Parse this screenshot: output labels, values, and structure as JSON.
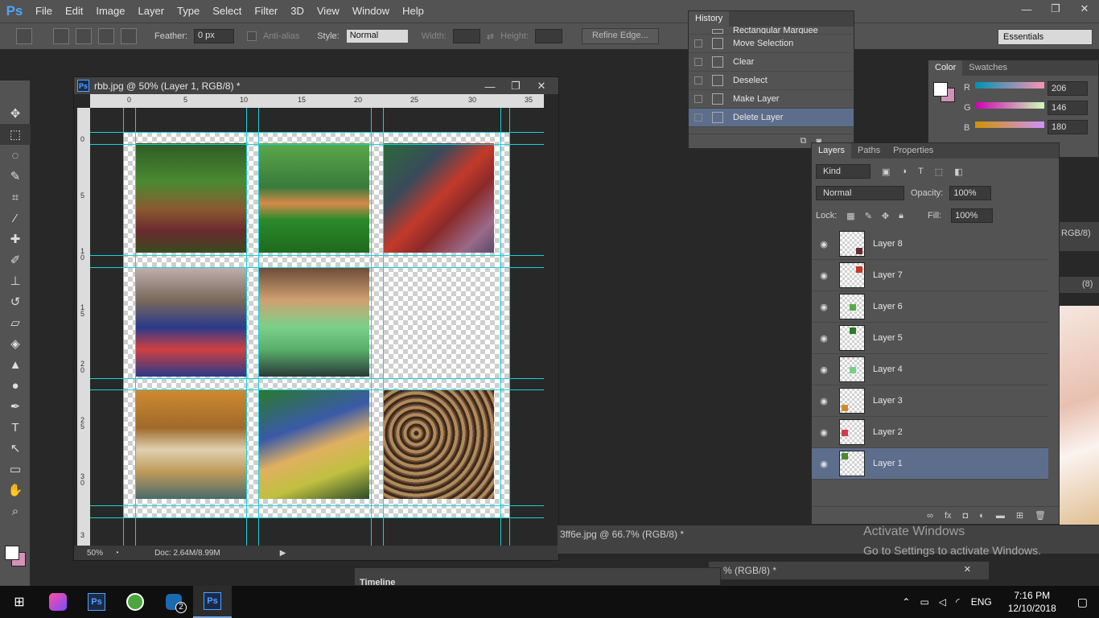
{
  "app": {
    "logo": "Ps"
  },
  "menu": [
    "File",
    "Edit",
    "Image",
    "Layer",
    "Type",
    "Select",
    "Filter",
    "3D",
    "View",
    "Window",
    "Help"
  ],
  "window_controls": {
    "minimize": "—",
    "restore": "❐",
    "close": "✕"
  },
  "options_bar": {
    "feather_label": "Feather:",
    "feather_value": "0 px",
    "antialias_label": "Anti-alias",
    "style_label": "Style:",
    "style_value": "Normal",
    "width_label": "Width:",
    "height_label": "Height:",
    "refine_edge": "Refine Edge...",
    "workspace": "Essentials"
  },
  "document": {
    "title": "rbb.jpg @ 50% (Layer 1, RGB/8) *",
    "zoom": "50%",
    "doc_size": "Doc: 2.64M/8.99M",
    "ruler_h": [
      "0",
      "5",
      "10",
      "15",
      "20",
      "25",
      "30",
      "35"
    ],
    "ruler_v": [
      "0",
      "5",
      "1\n0",
      "1\n5",
      "2\n0",
      "2\n5",
      "3\n0",
      "3"
    ]
  },
  "history": {
    "tab": "History",
    "items": [
      {
        "label": "Rectangular Marquee",
        "selected": false
      },
      {
        "label": "Move Selection",
        "selected": false
      },
      {
        "label": "Clear",
        "selected": false
      },
      {
        "label": "Deselect",
        "selected": false
      },
      {
        "label": "Make Layer",
        "selected": false
      },
      {
        "label": "Delete Layer",
        "selected": true
      }
    ]
  },
  "color_panel": {
    "tabs": [
      "Color",
      "Swatches"
    ],
    "r_label": "R",
    "g_label": "G",
    "b_label": "B",
    "r": "206",
    "g": "146",
    "b": "180",
    "fg": "#ffffff",
    "bg": "#ce92b4"
  },
  "layers_panel": {
    "tabs": [
      "Layers",
      "Paths",
      "Properties"
    ],
    "kind": "Kind",
    "blend_mode": "Normal",
    "opacity_label": "Opacity:",
    "opacity": "100%",
    "lock_label": "Lock:",
    "fill_label": "Fill:",
    "fill": "100%",
    "layers": [
      {
        "name": "Layer 8",
        "selected": false
      },
      {
        "name": "Layer 7",
        "selected": false
      },
      {
        "name": "Layer 6",
        "selected": false
      },
      {
        "name": "Layer 5",
        "selected": false
      },
      {
        "name": "Layer 4",
        "selected": false
      },
      {
        "name": "Layer 3",
        "selected": false
      },
      {
        "name": "Layer 2",
        "selected": false
      },
      {
        "name": "Layer 1",
        "selected": true
      }
    ]
  },
  "background_docs": {
    "doc2_title": "3ff6e.jpg @ 66.7% (RGB/8) *",
    "doc3_title": "% (RGB/8) *",
    "doc_partial": "RGB/8)",
    "doc_partial2": "(8)",
    "timeline": "Timeline"
  },
  "watermark": {
    "line1": "Activate Windows",
    "line2": "Go to Settings to activate Windows."
  },
  "taskbar": {
    "lang": "ENG",
    "time": "7:16 PM",
    "date": "12/10/2018",
    "badge": "2"
  },
  "colors": {
    "guide": "#19d0d8",
    "selection": "#5d6e8c",
    "panel": "#535353",
    "accent": "#4fa3ff"
  }
}
